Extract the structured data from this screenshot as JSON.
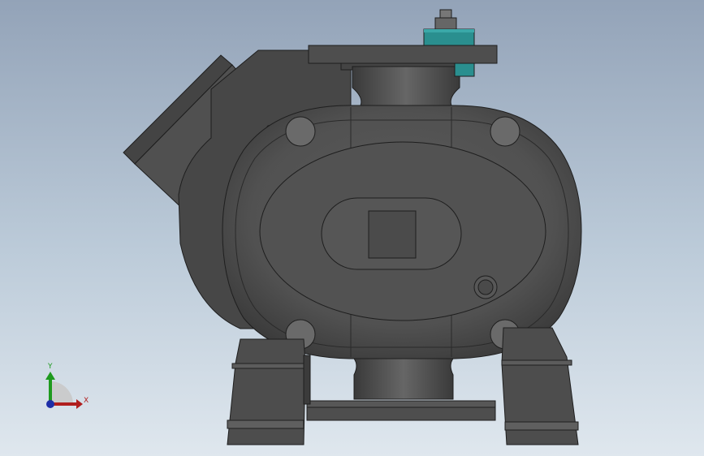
{
  "viewport": {
    "background_top": "#93a3b8",
    "background_bottom": "#dfe7ee"
  },
  "model": {
    "part_fill": "#5a5a5a",
    "part_dark": "#3f3f3f",
    "edge_color": "#1e1e1e",
    "accent_fill": "#2a8f8f"
  },
  "triad": {
    "x_label": "X",
    "y_label": "Y",
    "x_color": "#b01e1e",
    "y_color": "#1e9a1e",
    "z_color": "#1e2ea8"
  }
}
